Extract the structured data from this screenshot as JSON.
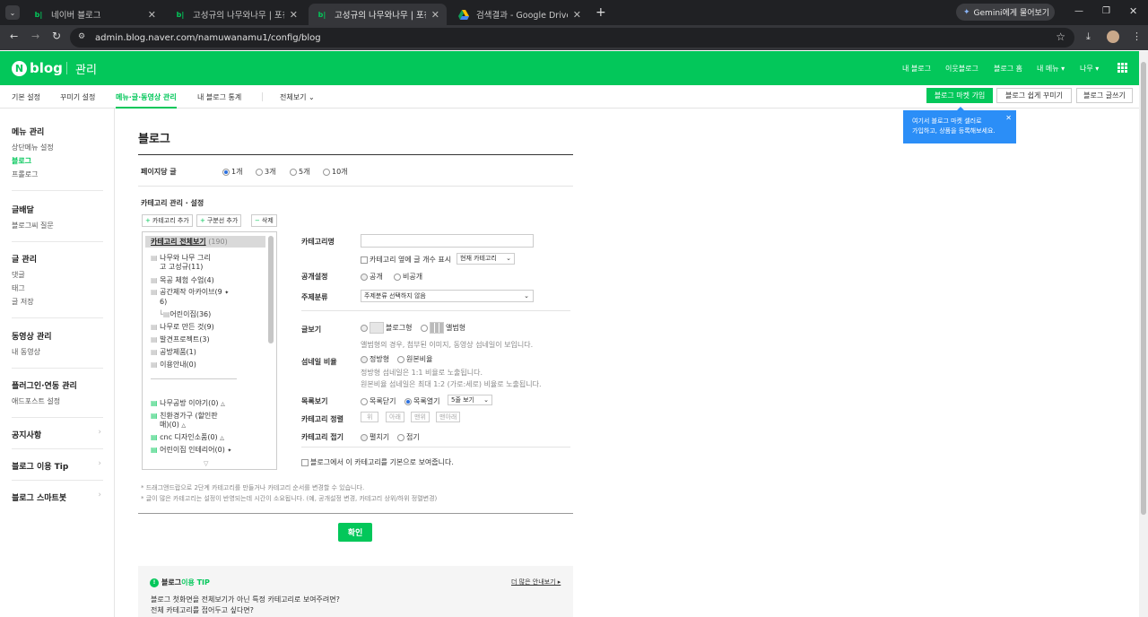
{
  "browser": {
    "tabs": [
      {
        "title": "네이버 블로그",
        "active": false
      },
      {
        "title": "고성규의 나무와나무 | 포천 목",
        "active": false
      },
      {
        "title": "고성규의 나무와나무 | 포천 목",
        "active": true
      },
      {
        "title": "검색결과 - Google Drive",
        "active": false
      }
    ],
    "gemini": "Gemini에게 물어보기",
    "url": "admin.blog.naver.com/namuwanamu1/config/blog"
  },
  "header": {
    "logo_n": "N",
    "logo_text": "blog",
    "section": "관리",
    "links": [
      "내 블로그",
      "이웃블로그",
      "블로그 홈",
      "내 메뉴 ▾",
      "나무 ▾"
    ]
  },
  "subnav": {
    "tabs": [
      "기본 설정",
      "꾸미기 설정",
      "메뉴·글·동영상 관리",
      "내 블로그 통계",
      "전체보기"
    ],
    "active_index": 2,
    "buttons": [
      "블로그 마켓 가입",
      "블로그 쉽게 꾸미기",
      "블로그 글쓰기"
    ]
  },
  "tooltip": {
    "line1": "여기서 블로그 마켓 셀러로",
    "line2": "가입하고, 상품을 등록해보세요."
  },
  "sidebar": [
    {
      "heading": "메뉴 관리",
      "items": [
        "상단메뉴 설정",
        "블로그",
        "프롤로그"
      ],
      "active": "블로그"
    },
    {
      "heading": "글배달",
      "items": [
        "블로그씨 질문"
      ]
    },
    {
      "heading": "글 관리",
      "items": [
        "댓글",
        "태그",
        "글 저장"
      ]
    },
    {
      "heading": "동영상 관리",
      "items": [
        "내 동영상"
      ]
    },
    {
      "heading": "플러그인·연동 관리",
      "items": [
        "애드포스트 설정"
      ]
    },
    {
      "heading": "공지사항",
      "items": []
    },
    {
      "heading": "블로그 이용 Tip",
      "items": []
    },
    {
      "heading": "블로그 스마트봇",
      "items": []
    }
  ],
  "main": {
    "title": "블로그",
    "per_page_label": "페이지당 글",
    "per_page_options": [
      "1개",
      "3개",
      "5개",
      "10개"
    ],
    "per_page_selected": 0,
    "category_title": "카테고리 관리 · 설정",
    "cat_buttons": [
      "카테고리 추가",
      "구분선 추가",
      "삭제"
    ],
    "tree_root": "카테고리 전체보기",
    "tree_root_count": "(190)",
    "tree_items": [
      {
        "text": "나무와 나무 그리",
        "sub": "고 고성규(11)"
      },
      {
        "text": "목공 체험 수업(4)",
        "sub": ""
      },
      {
        "text": "공간제작 아카이브(9",
        "sub": "6)"
      },
      {
        "text": "어린이집(36)",
        "sub": "",
        "child": true
      },
      {
        "text": "나무로 만든 것(9)",
        "sub": ""
      },
      {
        "text": "발견프로젝트(3)",
        "sub": ""
      },
      {
        "text": "공방제품(1)",
        "sub": ""
      },
      {
        "text": "이용안내(0)",
        "sub": ""
      }
    ],
    "tree_items2": [
      {
        "text": "나무공방 이야기(0)",
        "sub": ""
      },
      {
        "text": "친환경가구 (할인판",
        "sub": "매)(0)"
      },
      {
        "text": "cnc 디자인소품(0)",
        "sub": ""
      },
      {
        "text": "어린이집 인테리어(0)",
        "sub": ""
      }
    ],
    "form": {
      "name_label": "카테고리명",
      "show_count": "카테고리 옆에 글 개수 표시",
      "count_select": "현재 카테고리",
      "open_label": "공개설정",
      "open_opts": [
        "공개",
        "비공개"
      ],
      "topic_label": "주제분류",
      "topic_value": "주제분류 선택하지 않음",
      "view_label": "글보기",
      "view_opts": [
        "블로그형",
        "앨범형"
      ],
      "view_note": "앨범형의 경우, 첨부된 이미지, 동영상 섬네일이 보입니다.",
      "thumb_label": "섬네일 비율",
      "thumb_opts": [
        "정방형",
        "원본비율"
      ],
      "thumb_note1": "정방형 섬네일은 1:1 비율로 노출됩니다.",
      "thumb_note2": "원본비율 섬네일은 최대 1:2 (가로:세로) 비율로 노출됩니다.",
      "list_label": "목록보기",
      "list_opts": [
        "목록닫기",
        "목록열기"
      ],
      "list_select": "5줄 보기",
      "sort_label": "카테고리 정렬",
      "sort_btns": [
        "위",
        "아래",
        "맨위",
        "맨아래"
      ],
      "fold_label": "카테고리 접기",
      "fold_opts": [
        "펼치기",
        "접기"
      ],
      "default_check": "블로그에서 이 카테고리를 기본으로 보여줍니다."
    },
    "notes": [
      "* 드래그앤드랍으로 2단계 카테고리를 만들거나 카테고리 순서를 변경할 수 있습니다.",
      "* 글이 많은 카테고리는 설정이 반영되는데 시간이 소요됩니다. (예, 공개설정 변경, 카테고리 상위/하위 정렬변경)"
    ],
    "confirm": "확인",
    "tip_brand": "블로그",
    "tip_word": " 이용 TIP",
    "tip_more": "더 많은 안내보기 ▸",
    "tip_items": [
      "블로그 첫화면을 전체보기가 아닌 특정 카테고리로 보여주려면?",
      "전체 카테고리를 접어두고 싶다면?"
    ]
  },
  "colors": {
    "brand": "#03c75a",
    "tooltip": "#2b8ef7"
  }
}
